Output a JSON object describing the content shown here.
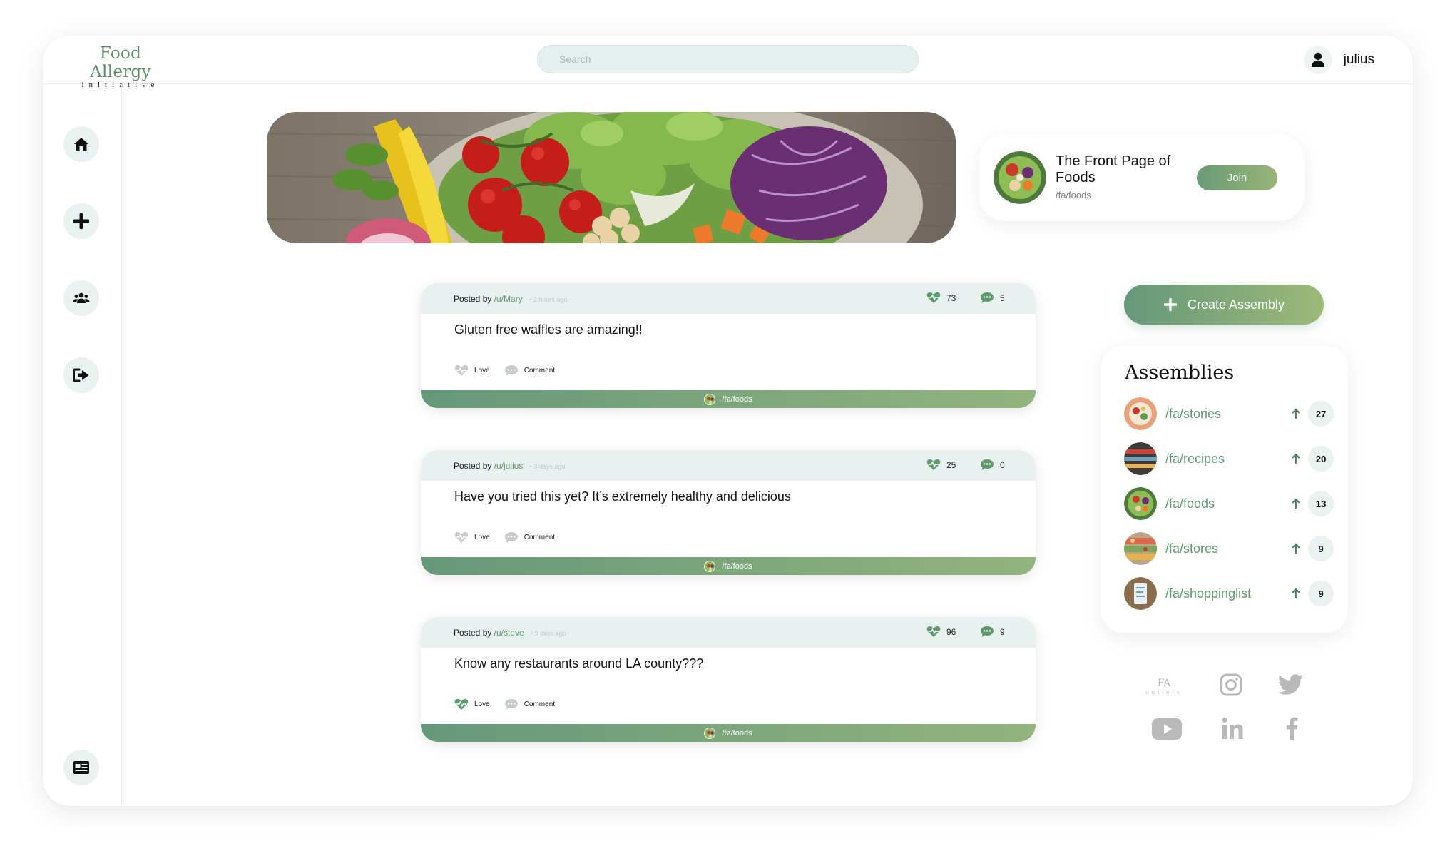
{
  "header": {
    "logo_main": "Food Allergy",
    "logo_sub": "initiative",
    "search_placeholder": "Search",
    "username": "julius"
  },
  "community": {
    "title": "The Front Page of Foods",
    "path": "/fa/foods",
    "join_label": "Join"
  },
  "posts": [
    {
      "posted_by": "Posted by",
      "author": "/u/Mary",
      "time": "2 hours ago",
      "loves": "73",
      "comments": "5",
      "title": "Gluten free waffles are amazing!!",
      "love_label": "Love",
      "comment_label": "Comment",
      "community": "/fa/foods",
      "loved": false
    },
    {
      "posted_by": "Posted by",
      "author": "/u/julius",
      "time": "3 days ago",
      "loves": "25",
      "comments": "0",
      "title": "Have you tried this yet? It’s extremely healthy and delicious",
      "love_label": "Love",
      "comment_label": "Comment",
      "community": "/fa/foods",
      "loved": false
    },
    {
      "posted_by": "Posted by",
      "author": "/u/steve",
      "time": "9 days ago",
      "loves": "96",
      "comments": "9",
      "title": "Know any restaurants around LA county???",
      "love_label": "Love",
      "comment_label": "Comment",
      "community": "/fa/foods",
      "loved": true
    }
  ],
  "create_assembly": {
    "label": "Create Assembly"
  },
  "assemblies": {
    "title": "Assemblies",
    "items": [
      {
        "name": "/fa/stories",
        "count": "27"
      },
      {
        "name": "/fa/recipes",
        "count": "20"
      },
      {
        "name": "/fa/foods",
        "count": "13"
      },
      {
        "name": "/fa/stores",
        "count": "9"
      },
      {
        "name": "/fa/shoppinglist",
        "count": "9"
      }
    ]
  },
  "footer_logo": {
    "main": "FA",
    "sub": "outlets"
  },
  "colors": {
    "accent": "#66987a",
    "accent_light": "#9cb978",
    "surface": "#e9f1f1"
  },
  "icons": [
    "home-icon",
    "plus-icon",
    "group-icon",
    "logout-icon",
    "news-card-icon",
    "heart-icon",
    "comment-icon",
    "arrow-up-icon",
    "instagram-icon",
    "twitter-icon",
    "youtube-icon",
    "linkedin-icon",
    "facebook-icon"
  ]
}
